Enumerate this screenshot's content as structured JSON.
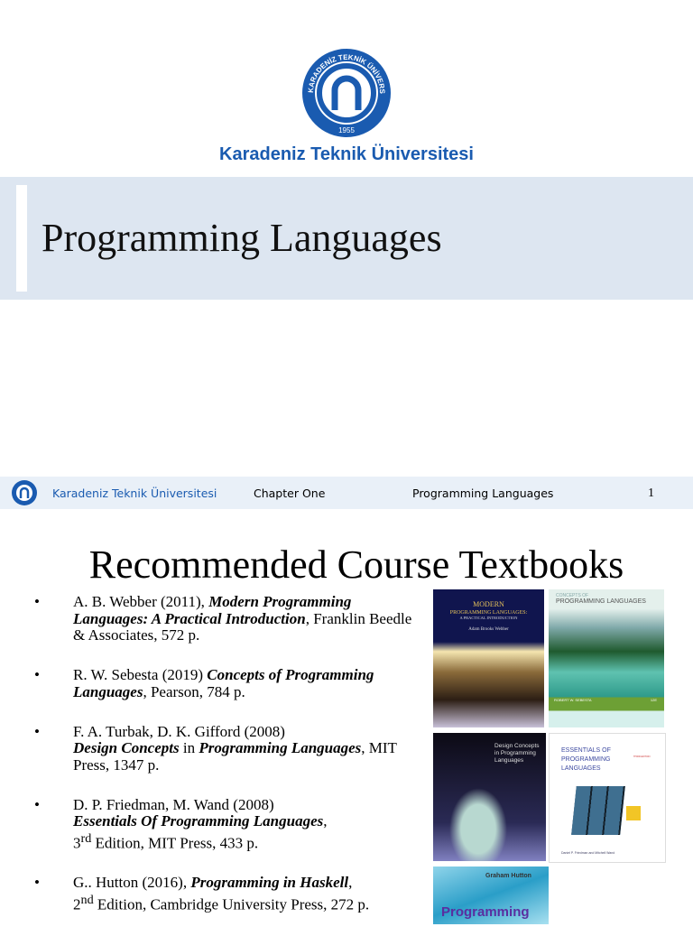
{
  "logo": {
    "ring_text": "KARADENİZ TEKNİK ÜNİVERSİTESİ",
    "year": "1955"
  },
  "university": "Karadeniz Teknik Üniversitesi",
  "title": "Programming Languages",
  "footer": {
    "university": "Karadeniz Teknik Üniversitesi",
    "chapter": "Chapter One",
    "course": "Programming Languages",
    "page": "1"
  },
  "heading": "Recommended Course Textbooks",
  "books": [
    {
      "a": "A. B. Webber (2011), ",
      "t": "Modern Programming Languages: A Practical Introduction",
      "b": ", Franklin Beedle & Associates, 572 p."
    },
    {
      "a": "R. W. Sebesta (2019) ",
      "t": "Concepts of Programming Languages",
      "b": ", Pearson, 784 p."
    },
    {
      "a": "F. A. Turbak, D. K. Gifford (2008)",
      "t1": "Design Concepts",
      "m": " in ",
      "t": "Programming Languages",
      "b": ", MIT Press, 1347 p."
    },
    {
      "a": "D. P. Friedman, M. Wand (2008)",
      "t": "Essentials Of Programming Languages",
      "b": ",",
      "ed": "3",
      "sup": "rd",
      "c": " Edition, MIT Press, 433 p."
    },
    {
      "a": "G.. Hutton (2016), ",
      "t": "Programming in Haskell",
      "b": ",",
      "ed": "2",
      "sup": "nd",
      "c": " Edition, Cambridge University Press, 272 p."
    }
  ],
  "covers": {
    "webber": {
      "l1": "MODERN",
      "l2": "PROGRAMMING LANGUAGES:",
      "l3": "A PRACTICAL INTRODUCTION",
      "au": "Adam Brooks Webber"
    },
    "sebesta": {
      "l1": "CONCEPTS OF",
      "l2": "PROGRAMMING LANGUAGES",
      "au": "ROBERT W. SEBESTA",
      "ed": "12E"
    },
    "turbak": {
      "l1": "Design Concepts",
      "l2": "in Programming",
      "l3": "Languages"
    },
    "friedman": {
      "l1": "ESSENTIALS OF",
      "l2": "PROGRAMMING",
      "l3": "LANGUAGES",
      "ed": "THIRD EDITION",
      "au": "Daniel P. Friedman and Mitchell Wand"
    },
    "hutton": {
      "au": "Graham Hutton",
      "l1": "Programming"
    }
  }
}
